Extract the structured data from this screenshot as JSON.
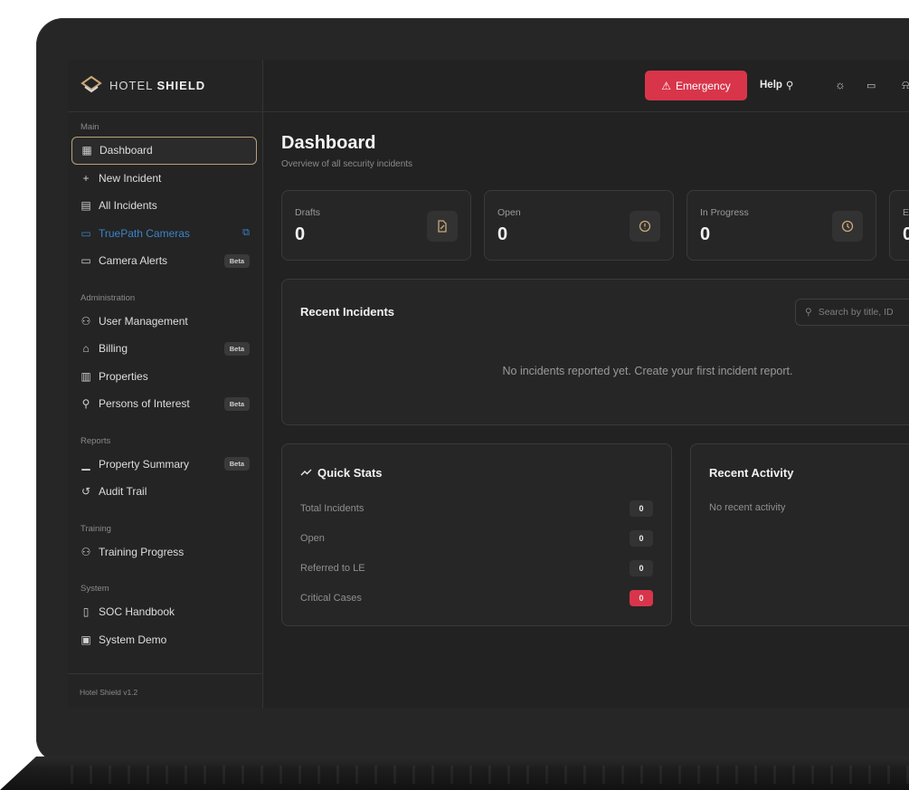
{
  "brand": {
    "prefix": "HOTEL",
    "name": "SHIELD"
  },
  "sidebar": {
    "sections": [
      {
        "label": "Main",
        "items": [
          {
            "label": "Dashboard",
            "icon": "grid-icon",
            "active": true
          },
          {
            "label": "New Incident",
            "icon": "plus-icon"
          },
          {
            "label": "All Incidents",
            "icon": "document-icon"
          },
          {
            "label": "TruePath Cameras",
            "icon": "camera-icon",
            "external": true
          },
          {
            "label": "Camera Alerts",
            "icon": "camera-icon",
            "badge": "Beta"
          }
        ]
      },
      {
        "label": "Administration",
        "items": [
          {
            "label": "User Management",
            "icon": "users-icon"
          },
          {
            "label": "Billing",
            "icon": "bank-icon",
            "badge": "Beta"
          },
          {
            "label": "Properties",
            "icon": "building-icon"
          },
          {
            "label": "Persons of Interest",
            "icon": "user-search-icon",
            "badge": "Beta"
          }
        ]
      },
      {
        "label": "Reports",
        "items": [
          {
            "label": "Property Summary",
            "icon": "bar-chart-icon",
            "badge": "Beta"
          },
          {
            "label": "Audit Trail",
            "icon": "history-icon"
          }
        ]
      },
      {
        "label": "Training",
        "items": [
          {
            "label": "Training Progress",
            "icon": "users-icon"
          }
        ]
      },
      {
        "label": "System",
        "items": [
          {
            "label": "SOC Handbook",
            "icon": "book-icon"
          },
          {
            "label": "System Demo",
            "icon": "monitor-icon"
          }
        ]
      }
    ],
    "footer": "Hotel Shield v1.2"
  },
  "topbar": {
    "emergency_label": "Emergency",
    "help_label": "Help"
  },
  "page": {
    "title": "Dashboard",
    "subtitle": "Overview of all security incidents"
  },
  "stats": [
    {
      "label": "Drafts",
      "value": "0",
      "icon": "draft-file-icon"
    },
    {
      "label": "Open",
      "value": "0",
      "icon": "alert-circle-icon"
    },
    {
      "label": "In Progress",
      "value": "0",
      "icon": "clock-icon"
    },
    {
      "label": "E",
      "value": "0",
      "icon": ""
    }
  ],
  "recent_incidents": {
    "title": "Recent Incidents",
    "search_placeholder": "Search by title, ID",
    "empty": "No incidents reported yet. Create your first incident report."
  },
  "quick_stats": {
    "title": "Quick Stats",
    "rows": [
      {
        "label": "Total Incidents",
        "value": "0",
        "color": "#333333"
      },
      {
        "label": "Open",
        "value": "0",
        "color": "#333333"
      },
      {
        "label": "Referred to LE",
        "value": "0",
        "color": "#333333"
      },
      {
        "label": "Critical Cases",
        "value": "0",
        "color": "#d8354a"
      }
    ]
  },
  "recent_activity": {
    "title": "Recent Activity",
    "empty": "No recent activity"
  },
  "colors": {
    "accent": "#b9a07a",
    "danger": "#d8354a",
    "link": "#3a83c8"
  }
}
